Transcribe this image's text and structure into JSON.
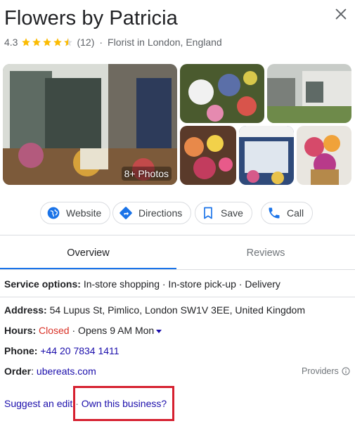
{
  "business": {
    "name": "Flowers by Patricia",
    "rating": "4.3",
    "rating_value": 4.3,
    "review_count": "(12)",
    "separator": "·",
    "category": "Florist in London, England"
  },
  "photos": {
    "count_label": "8+ Photos"
  },
  "actions": {
    "website": "Website",
    "directions": "Directions",
    "save": "Save",
    "call": "Call"
  },
  "tabs": {
    "overview": "Overview",
    "reviews": "Reviews"
  },
  "service_options": {
    "label": "Service options:",
    "value": "In-store shopping · In-store pick-up · Delivery"
  },
  "address": {
    "label": "Address:",
    "value": "54 Lupus St, Pimlico, London SW1V 3EE, United Kingdom"
  },
  "hours": {
    "label": "Hours:",
    "status": "Closed",
    "opens": "· Opens 9 AM Mon"
  },
  "phone": {
    "label": "Phone:",
    "value": "+44 20 7834 1411"
  },
  "order": {
    "label": "Order",
    "separator": ":",
    "value": "ubereats.com",
    "providers": "Providers"
  },
  "footer": {
    "suggest_edit": "Suggest an edit",
    "separator": "·",
    "own_business": "Own this business?"
  },
  "colors": {
    "star": "#fbbc04",
    "link": "#1a0dab",
    "accent": "#1a73e8",
    "closed": "#d93025",
    "highlight": "#d6202f"
  },
  "icons": {
    "close": "close-icon",
    "website": "globe-icon",
    "directions": "directions-icon",
    "save": "bookmark-icon",
    "call": "phone-icon",
    "providers": "info-icon"
  }
}
